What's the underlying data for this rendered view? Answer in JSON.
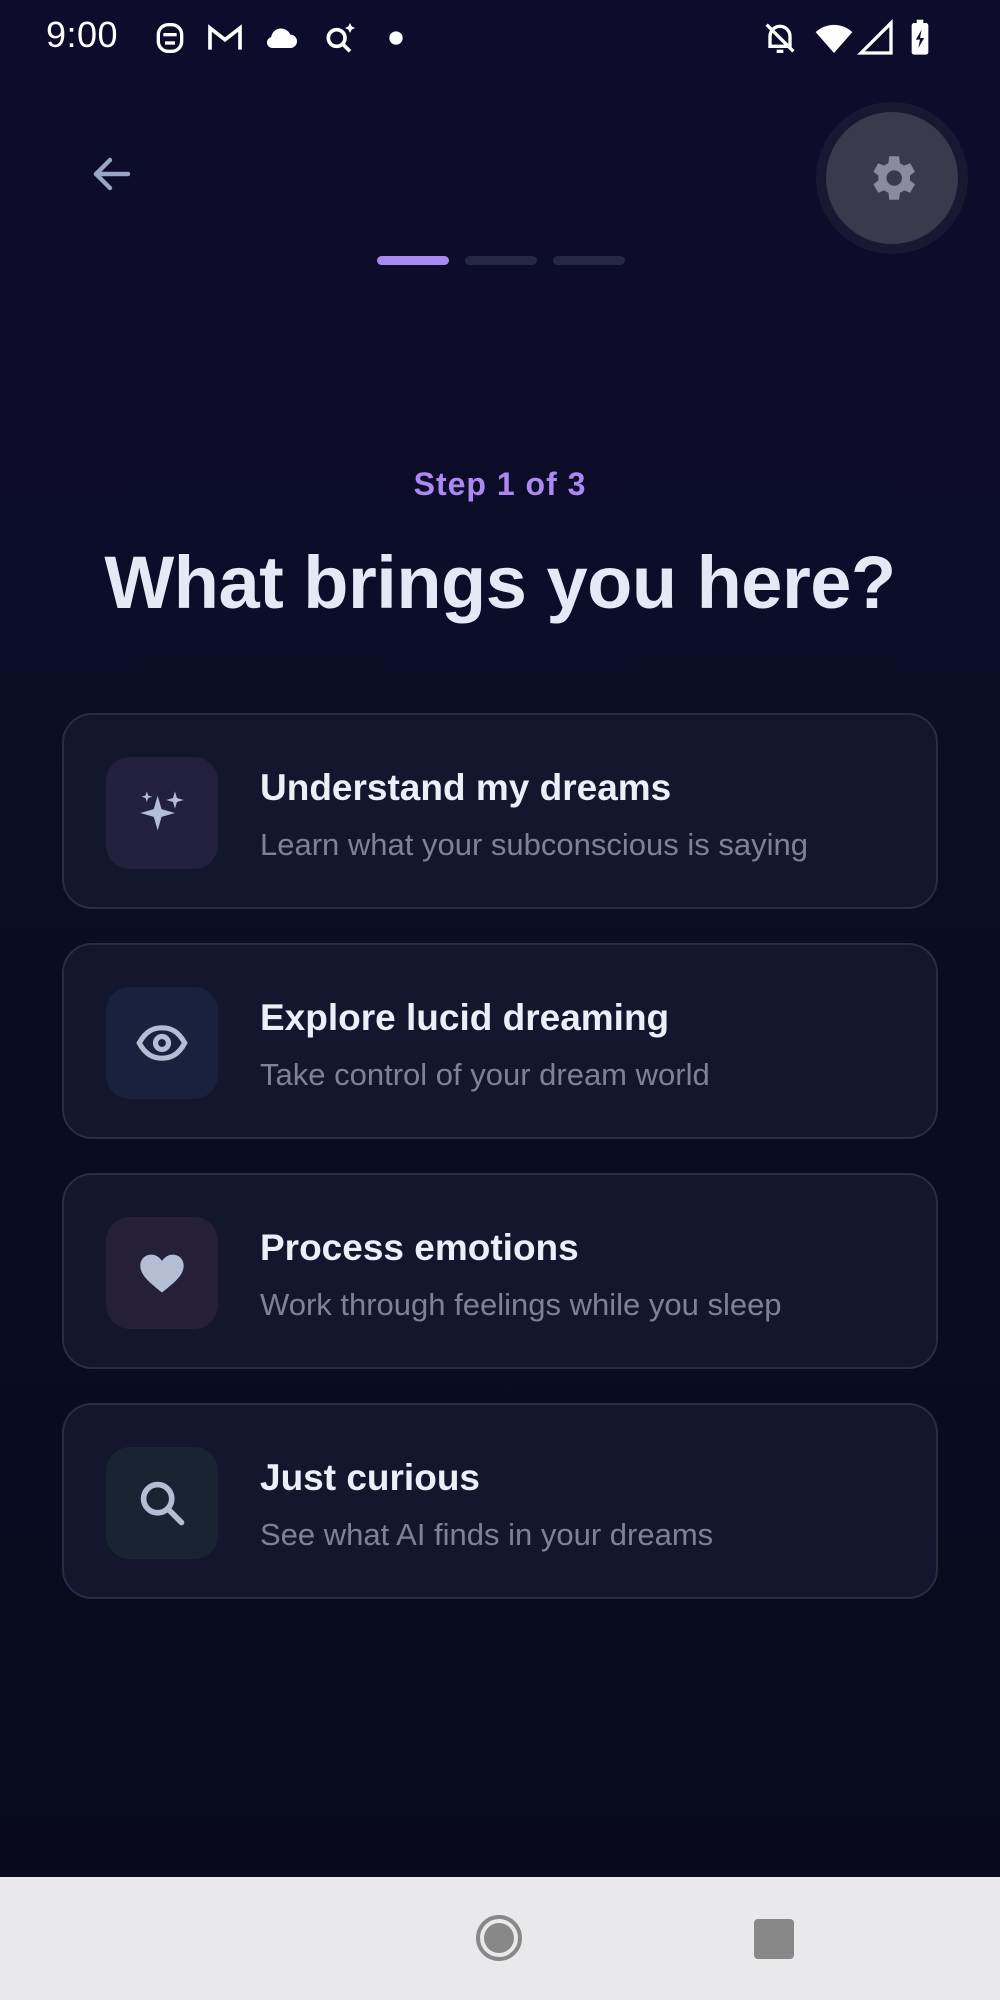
{
  "status_bar": {
    "time": "9:00",
    "left_icons": [
      "face-icon",
      "gmail-icon",
      "cloud-icon",
      "sparkle-search-icon",
      "dot-icon"
    ],
    "right_icons": [
      "bell-off-icon",
      "wifi-icon",
      "signal-icon",
      "battery-charging-icon"
    ]
  },
  "header": {
    "back_icon": "arrow-left-icon",
    "settings_icon": "gear-icon"
  },
  "progress": {
    "total_steps": 3,
    "current_step": 1
  },
  "main": {
    "step_label": "Step 1 of 3",
    "title": "What brings you here?",
    "options": [
      {
        "icon": "sparkles-icon",
        "title": "Understand my dreams",
        "description": "Learn what your subconscious is saying",
        "icon_bg": "#221f3f"
      },
      {
        "icon": "eye-icon",
        "title": "Explore lucid dreaming",
        "description": "Take control of your dream world",
        "icon_bg": "#18213d"
      },
      {
        "icon": "heart-icon",
        "title": "Process emotions",
        "description": "Work through feelings while you sleep",
        "icon_bg": "#251f38"
      },
      {
        "icon": "search-icon",
        "title": "Just curious",
        "description": "See what AI finds in your dreams",
        "icon_bg": "#182431"
      }
    ]
  },
  "colors": {
    "accent": "#a98af0",
    "title": "#e6e9f5",
    "description": "#7c8399",
    "card_bg": "#14162d",
    "card_border": "#2a2c46",
    "icon_fg": "#b4bdd3"
  },
  "nav_bar": {
    "icons": [
      "home-circle-icon",
      "recents-square-icon"
    ]
  }
}
